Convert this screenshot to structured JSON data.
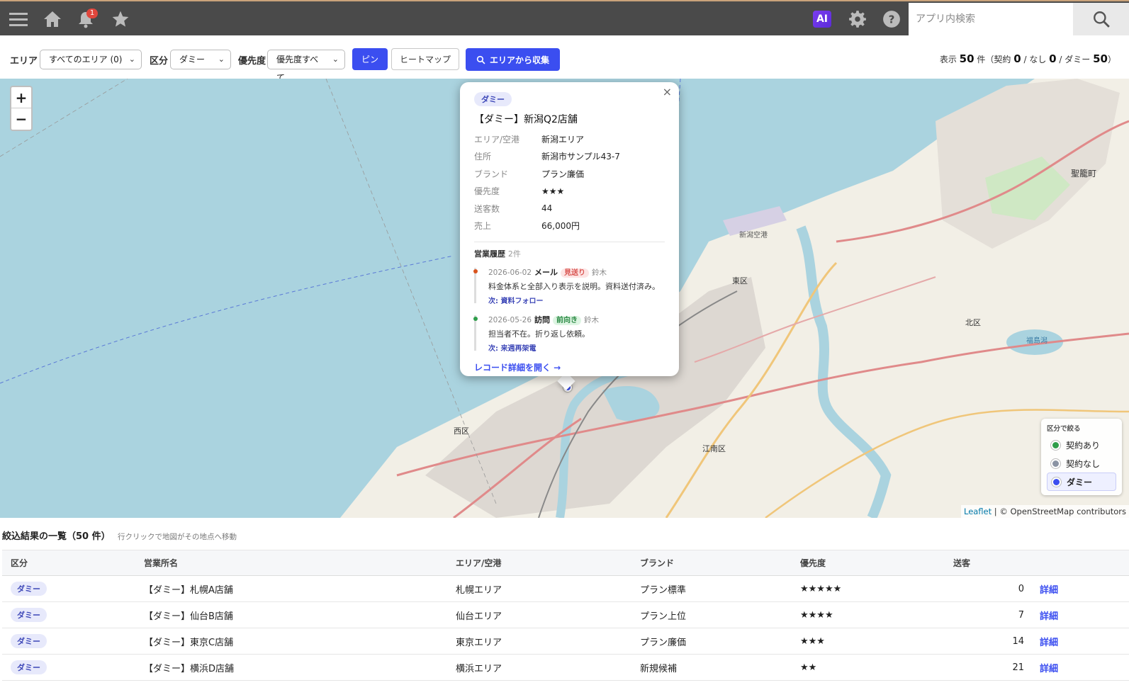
{
  "topbar": {
    "notification_count": "1",
    "ai_label": "AI",
    "search_placeholder": "アプリ内検索"
  },
  "filters": {
    "area_label": "エリア",
    "area_value": "すべてのエリア (0)",
    "category_label": "区分",
    "category_value": "ダミー",
    "priority_label": "優先度",
    "priority_value": "優先度すべて",
    "pin_label": "ピン",
    "heatmap_label": "ヒートマップ",
    "collect_label": "エリアから収集",
    "summary": {
      "display_prefix": "表示",
      "total": "50",
      "unit": "件（契約",
      "contract": "0",
      "none_prefix": "/ なし",
      "none": "0",
      "dummy_prefix": "/ ダミー",
      "dummy": "50",
      "suffix": "）"
    }
  },
  "map": {
    "zoom_in": "+",
    "zoom_out": "−",
    "attribution_leaflet": "Leaflet",
    "attribution_rest": "| © OpenStreetMap contributors",
    "place_labels": [
      "新潟空港",
      "東区",
      "北区",
      "西区",
      "江南区",
      "聖籠町",
      "福島潟"
    ],
    "legend": {
      "title": "区分で絞る",
      "items": [
        {
          "label": "契約あり",
          "color": "#2e9d4a"
        },
        {
          "label": "契約なし",
          "color": "#8a93a3"
        },
        {
          "label": "ダミー",
          "color": "#3b4ef0"
        }
      ]
    }
  },
  "popup": {
    "tag": "ダミー",
    "title": "【ダミー】新潟Q2店舗",
    "fields": [
      {
        "key": "エリア/空港",
        "value": "新潟エリア"
      },
      {
        "key": "住所",
        "value": "新潟市サンプル43-7"
      },
      {
        "key": "ブランド",
        "value": "プラン廉価"
      },
      {
        "key": "優先度",
        "value": "★★★"
      },
      {
        "key": "送客数",
        "value": "44"
      },
      {
        "key": "売上",
        "value": "66,000円"
      }
    ],
    "history_title": "営業履歴",
    "history_count": "2件",
    "history": [
      {
        "date": "2026-06-02",
        "type": "メール",
        "status": "見送り",
        "status_color": "#d9534f",
        "status_bg": "#fde4e4",
        "user": "鈴木",
        "text": "料金体系と全部入り表示を説明。資料送付済み。",
        "next": "次: 資料フォロー",
        "dot_color": "#d9541e"
      },
      {
        "date": "2026-05-26",
        "type": "訪問",
        "status": "前向き",
        "status_color": "#2e8b46",
        "status_bg": "#def5e3",
        "user": "鈴木",
        "text": "担当者不在。折り返し依頼。",
        "next": "次: 来週再架電",
        "dot_color": "#2e9d4a"
      }
    ],
    "open_link": "レコード詳細を開く →",
    "close": "×"
  },
  "list": {
    "title": "絞込結果の一覧（50 件）",
    "hint": "行クリックで地図がその地点へ移動",
    "columns": [
      "区分",
      "営業所名",
      "エリア/空港",
      "ブランド",
      "優先度",
      "送客"
    ],
    "rows": [
      {
        "category": "ダミー",
        "name": "【ダミー】札幌A店舗",
        "area": "札幌エリア",
        "brand": "プラン標準",
        "priority": "★★★★★",
        "sent": "0",
        "detail": "詳細"
      },
      {
        "category": "ダミー",
        "name": "【ダミー】仙台B店舗",
        "area": "仙台エリア",
        "brand": "プラン上位",
        "priority": "★★★★",
        "sent": "7",
        "detail": "詳細"
      },
      {
        "category": "ダミー",
        "name": "【ダミー】東京C店舗",
        "area": "東京エリア",
        "brand": "プラン廉価",
        "priority": "★★★",
        "sent": "14",
        "detail": "詳細"
      },
      {
        "category": "ダミー",
        "name": "【ダミー】横浜D店舗",
        "area": "横浜エリア",
        "brand": "新規候補",
        "priority": "★★",
        "sent": "21",
        "detail": "詳細"
      }
    ]
  }
}
